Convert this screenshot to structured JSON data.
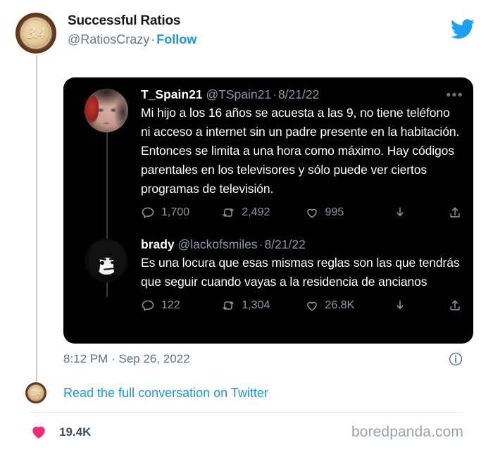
{
  "account": {
    "display_name": "Successful Ratios",
    "handle": "@RatiosCrazy",
    "separator": "·",
    "follow_label": "Follow",
    "avatar_text": "3.4",
    "avatar_icon": "coffee-cup-avatar"
  },
  "brand": {
    "twitter_icon": "twitter-bird-icon",
    "twitter_blue": "#1DA1F2",
    "accent_link": "#1b95e0"
  },
  "tweets": [
    {
      "name": "T_Spain21",
      "handle": "@TSpain21",
      "separator": "·",
      "date": "8/21/22",
      "text": "Mi hijo a los 16 años se acuesta a las 9, no tiene teléfono ni acceso a internet sin un padre presente en la habitación. Entonces se limita a una hora como máximo. Hay códigos parentales en los televisores y sólo puede ver ciertos programas de televisión.",
      "avatar_icon": "woman-portrait-avatar",
      "more_label": "•••",
      "stats": {
        "replies": "1,700",
        "retweets": "2,492",
        "likes": "995"
      }
    },
    {
      "name": "brady",
      "handle": "@lackofsmiles",
      "separator": "·",
      "date": "8/21/22",
      "text": "Es una locura que esas mismas reglas son las que tendrás que seguir cuando vayas a la residencia de ancianos",
      "avatar_icon": "manga-character-avatar",
      "stats": {
        "replies": "122",
        "retweets": "1,304",
        "likes": "26.8K"
      }
    }
  ],
  "post_footer": {
    "timestamp": "8:12 PM · Sep 26, 2022",
    "info_icon": "info-circle-icon",
    "read_more_label": "Read the full conversation on Twitter"
  },
  "page_footer": {
    "like_count": "19.4K",
    "heart_icon": "heart-icon",
    "heart_color": "#f42a7b",
    "watermark": "boredpanda.com"
  },
  "icons": {
    "reply": "reply-icon",
    "retweet": "retweet-icon",
    "like": "heart-outline-icon",
    "download": "download-icon",
    "share": "share-icon"
  }
}
